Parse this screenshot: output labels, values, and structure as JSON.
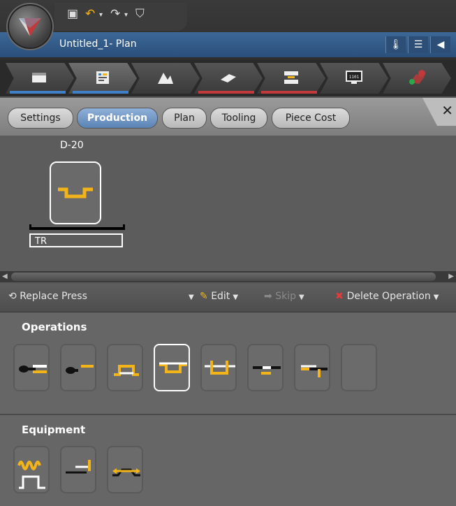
{
  "window": {
    "title": "Untitled_1- Plan"
  },
  "quick_access": [
    "save-icon",
    "undo-icon",
    "redo-icon",
    "filter-icon"
  ],
  "workflow_steps": [
    {
      "name": "part",
      "bar_color": "#3f7fc6"
    },
    {
      "name": "production",
      "bar_color": "#3f7fc6"
    },
    {
      "name": "tooling",
      "bar_color": "#3a3a3a"
    },
    {
      "name": "blank",
      "bar_color": "#c0393b"
    },
    {
      "name": "press",
      "bar_color": "#c0393b"
    },
    {
      "name": "numeric",
      "bar_color": "#3a3a3a"
    },
    {
      "name": "validate",
      "bar_color": "#3a3a3a"
    }
  ],
  "tabs": {
    "settings": "Settings",
    "production": "Production",
    "plan": "Plan",
    "tooling": "Tooling",
    "piece_cost": "Piece Cost",
    "close": "✕"
  },
  "plan": {
    "station_label": "D-20",
    "press_label": "TR"
  },
  "toolbar": {
    "replace_press": "Replace Press",
    "edit": "Edit",
    "skip": "Skip",
    "delete_operation": "Delete Operation"
  },
  "operations": {
    "header": "Operations",
    "selected_index": 3
  },
  "equipment": {
    "header": "Equipment"
  },
  "colors": {
    "accent_yellow": "#f2b418",
    "selection_white": "#ffffff",
    "delete_red": "#e23b3b"
  }
}
